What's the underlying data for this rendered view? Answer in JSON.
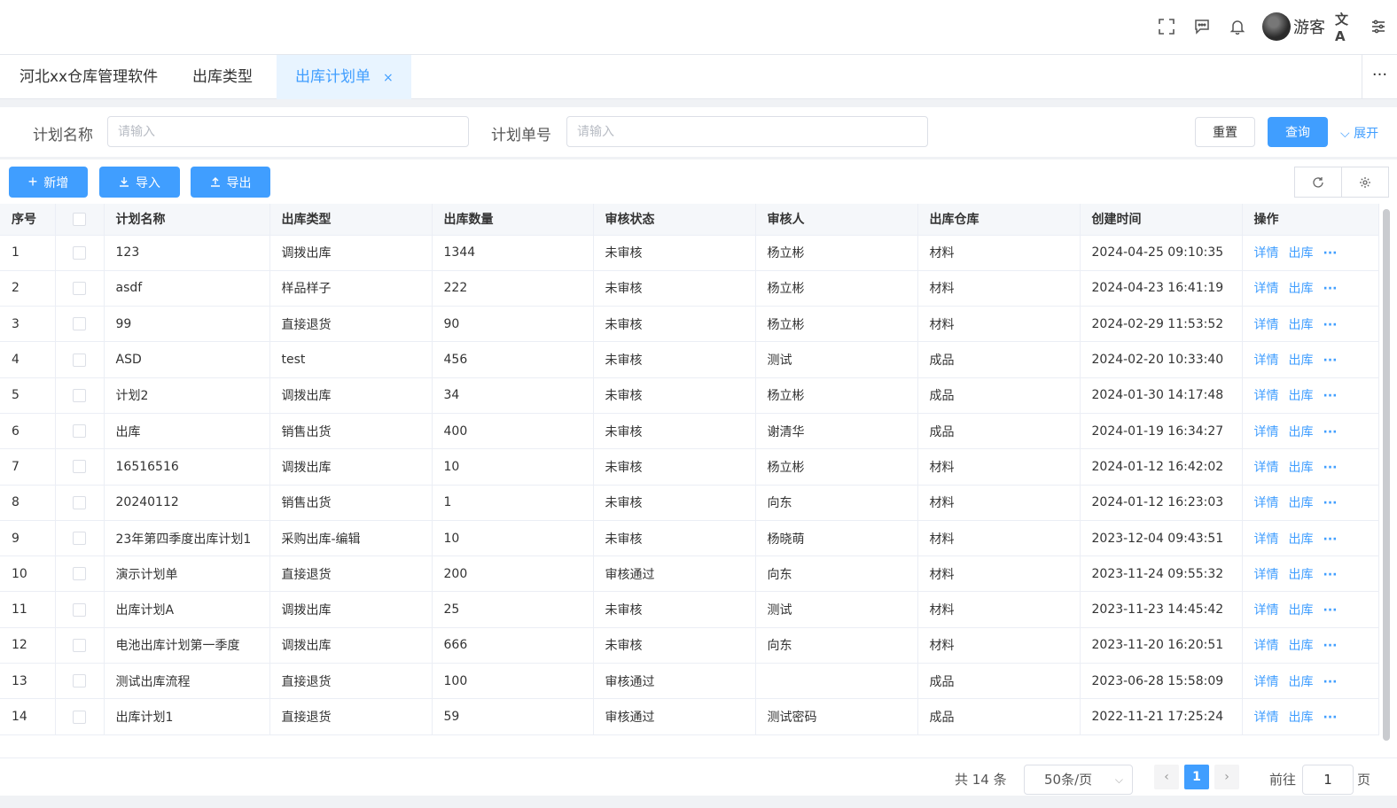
{
  "header": {
    "username": "游客",
    "language_icon_text": "文A"
  },
  "tabs": [
    {
      "label": "河北xx仓库管理软件"
    },
    {
      "label": "出库类型"
    },
    {
      "label": "出库计划单",
      "close": "×"
    }
  ],
  "search": {
    "plan_name_label": "计划名称",
    "plan_name_placeholder": "请输入",
    "plan_no_label": "计划单号",
    "plan_no_placeholder": "请输入",
    "reset_label": "重置",
    "query_label": "查询",
    "expand_label": "展开"
  },
  "toolbar": {
    "add_label": "新增",
    "import_label": "导入",
    "export_label": "导出"
  },
  "table": {
    "columns": [
      "序号",
      "",
      "计划名称",
      "出库类型",
      "出库数量",
      "审核状态",
      "审核人",
      "出库仓库",
      "创建时间",
      "操作"
    ],
    "detail_label": "详情",
    "outbound_label": "出库",
    "rows": [
      {
        "no": "1",
        "name": "123",
        "type": "调拨出库",
        "qty": "1344",
        "status": "未审核",
        "reviewer": "杨立彬",
        "warehouse": "材料",
        "time": "2024-04-25 09:10:35"
      },
      {
        "no": "2",
        "name": "asdf",
        "type": "样品样子",
        "qty": "222",
        "status": "未审核",
        "reviewer": "杨立彬",
        "warehouse": "材料",
        "time": "2024-04-23 16:41:19"
      },
      {
        "no": "3",
        "name": "99",
        "type": "直接退货",
        "qty": "90",
        "status": "未审核",
        "reviewer": "杨立彬",
        "warehouse": "材料",
        "time": "2024-02-29 11:53:52"
      },
      {
        "no": "4",
        "name": "ASD",
        "type": "test",
        "qty": "456",
        "status": "未审核",
        "reviewer": "测试",
        "warehouse": "成品",
        "time": "2024-02-20 10:33:40"
      },
      {
        "no": "5",
        "name": "计划2",
        "type": "调拨出库",
        "qty": "34",
        "status": "未审核",
        "reviewer": "杨立彬",
        "warehouse": "成品",
        "time": "2024-01-30 14:17:48"
      },
      {
        "no": "6",
        "name": "出库",
        "type": "销售出货",
        "qty": "400",
        "status": "未审核",
        "reviewer": "谢清华",
        "warehouse": "成品",
        "time": "2024-01-19 16:34:27"
      },
      {
        "no": "7",
        "name": "16516516",
        "type": "调拨出库",
        "qty": "10",
        "status": "未审核",
        "reviewer": "杨立彬",
        "warehouse": "材料",
        "time": "2024-01-12 16:42:02"
      },
      {
        "no": "8",
        "name": "20240112",
        "type": "销售出货",
        "qty": "1",
        "status": "未审核",
        "reviewer": "向东",
        "warehouse": "材料",
        "time": "2024-01-12 16:23:03"
      },
      {
        "no": "9",
        "name": "23年第四季度出库计划1",
        "type": "采购出库-编辑",
        "qty": "10",
        "status": "未审核",
        "reviewer": "杨晓萌",
        "warehouse": "材料",
        "time": "2023-12-04 09:43:51"
      },
      {
        "no": "10",
        "name": "演示计划单",
        "type": "直接退货",
        "qty": "200",
        "status": "审核通过",
        "reviewer": "向东",
        "warehouse": "材料",
        "time": "2023-11-24 09:55:32"
      },
      {
        "no": "11",
        "name": "出库计划A",
        "type": "调拨出库",
        "qty": "25",
        "status": "未审核",
        "reviewer": "测试",
        "warehouse": "材料",
        "time": "2023-11-23 14:45:42"
      },
      {
        "no": "12",
        "name": "电池出库计划第一季度",
        "type": "调拨出库",
        "qty": "666",
        "status": "未审核",
        "reviewer": "向东",
        "warehouse": "材料",
        "time": "2023-11-20 16:20:51"
      },
      {
        "no": "13",
        "name": "测试出库流程",
        "type": "直接退货",
        "qty": "100",
        "status": "审核通过",
        "reviewer": "",
        "warehouse": "成品",
        "time": "2023-06-28 15:58:09"
      },
      {
        "no": "14",
        "name": "出库计划1",
        "type": "直接退货",
        "qty": "59",
        "status": "审核通过",
        "reviewer": "测试密码",
        "warehouse": "成品",
        "time": "2022-11-21 17:25:24"
      }
    ]
  },
  "pagination": {
    "total_text": "共 14 条",
    "page_size": "50条/页",
    "current_page": "1",
    "goto_prefix": "前往",
    "goto_value": "1",
    "goto_suffix": "页"
  },
  "colors": {
    "accent": "#409eff",
    "active_tab_bg": "#e8f4ff"
  }
}
